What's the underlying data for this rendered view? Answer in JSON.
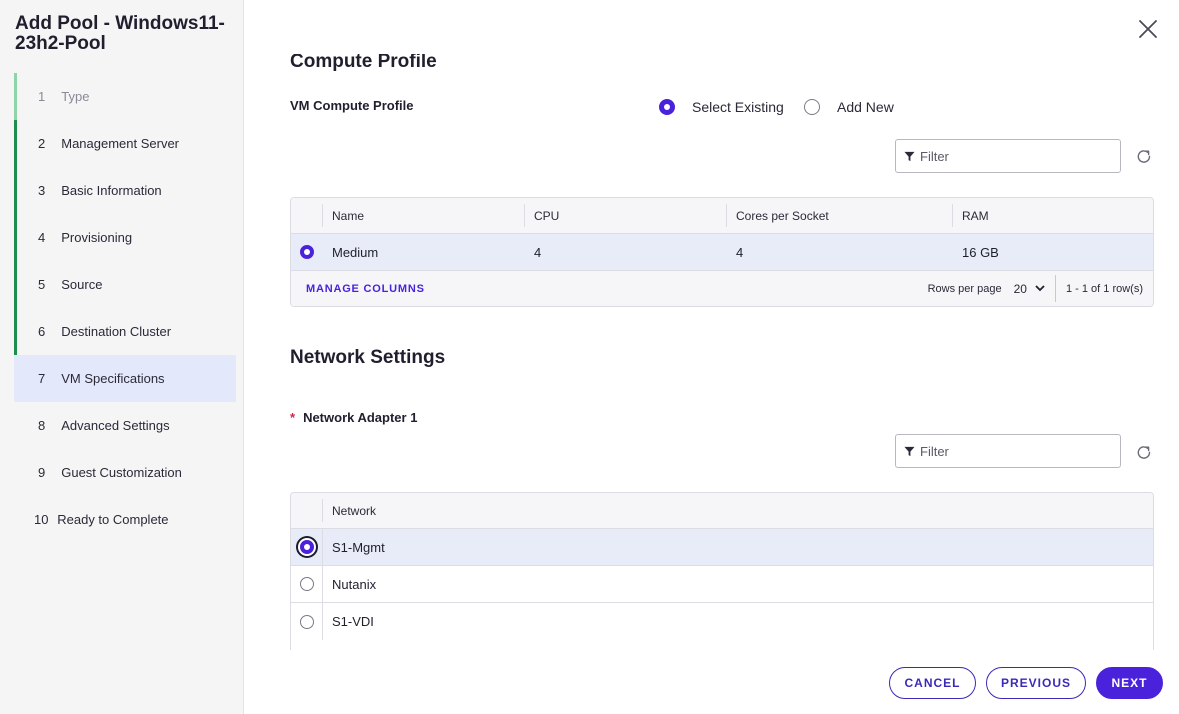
{
  "wizard": {
    "title": "Add Pool - Windows11-23h2-Pool",
    "steps": [
      {
        "num": "1",
        "label": "Type"
      },
      {
        "num": "2",
        "label": "Management Server"
      },
      {
        "num": "3",
        "label": "Basic Information"
      },
      {
        "num": "4",
        "label": "Provisioning"
      },
      {
        "num": "5",
        "label": "Source"
      },
      {
        "num": "6",
        "label": "Destination Cluster"
      },
      {
        "num": "7",
        "label": "VM Specifications"
      },
      {
        "num": "8",
        "label": "Advanced Settings"
      },
      {
        "num": "9",
        "label": "Guest Customization"
      },
      {
        "num": "10",
        "label": "Ready to Complete"
      }
    ],
    "active_step": "7"
  },
  "compute": {
    "section_title": "Compute Profile",
    "field_label": "VM Compute Profile",
    "option_existing": "Select Existing",
    "option_new": "Add New",
    "selected_option": "Select Existing",
    "filter_placeholder": "Filter",
    "columns": [
      "Name",
      "CPU",
      "Cores per Socket",
      "RAM"
    ],
    "rows": [
      {
        "name": "Medium",
        "cpu": "4",
        "cores": "4",
        "ram": "16 GB"
      }
    ],
    "manage_columns": "MANAGE COLUMNS",
    "rows_per_page_label": "Rows per page",
    "rows_per_page": "20",
    "rows_info": "1 - 1 of 1 row(s)"
  },
  "network": {
    "section_title": "Network Settings",
    "adapter_label": "Network Adapter 1",
    "required_mark": "*",
    "filter_placeholder": "Filter",
    "column": "Network",
    "rows": [
      "S1-Mgmt",
      "Nutanix",
      "S1-VDI"
    ],
    "selected": "S1-Mgmt"
  },
  "footer": {
    "cancel": "CANCEL",
    "previous": "PREVIOUS",
    "next": "NEXT"
  },
  "colors": {
    "accent": "#4a22dc",
    "step_done": "#1d8f4a",
    "required": "#d0244a"
  }
}
